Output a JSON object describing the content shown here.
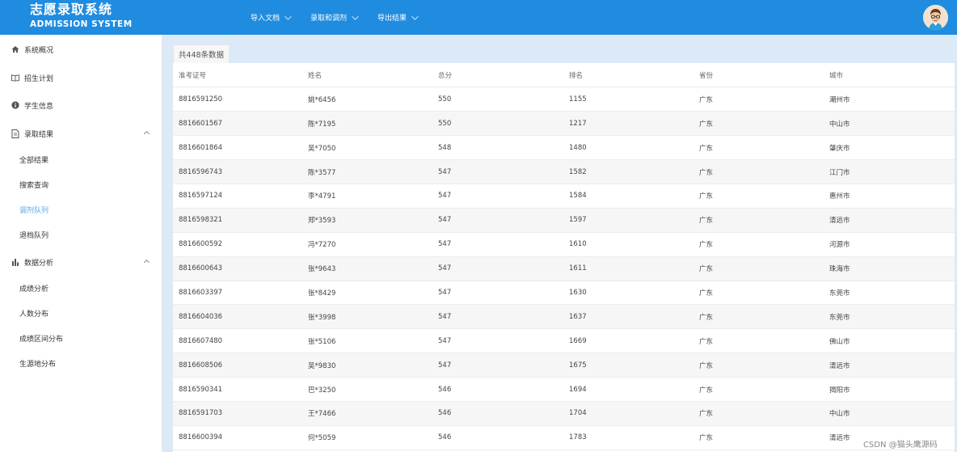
{
  "header": {
    "title_cn": "志愿录取系统",
    "title_en": "ADMISSION SYSTEM",
    "nav": [
      {
        "label": "导入文档"
      },
      {
        "label": "录取和调剂"
      },
      {
        "label": "导出结果"
      }
    ]
  },
  "sidebar": {
    "items": [
      {
        "label": "系统概况",
        "icon": "home-icon"
      },
      {
        "label": "招生计划",
        "icon": "book-icon"
      },
      {
        "label": "学生信息",
        "icon": "info-icon"
      },
      {
        "label": "录取结果",
        "icon": "document-icon"
      },
      {
        "label": "数据分析",
        "icon": "bar-chart-icon"
      }
    ],
    "results_sub": [
      {
        "label": "全部结果"
      },
      {
        "label": "搜索查询"
      },
      {
        "label": "调剂队列"
      },
      {
        "label": "退档队列"
      }
    ],
    "analysis_sub": [
      {
        "label": "成绩分析"
      },
      {
        "label": "人数分布"
      },
      {
        "label": "成绩区间分布"
      },
      {
        "label": "生源地分布"
      }
    ]
  },
  "main": {
    "tab_label": "共448条数据",
    "columns": [
      "准考证号",
      "姓名",
      "总分",
      "排名",
      "省份",
      "城市"
    ],
    "rows": [
      [
        "8816591250",
        "姚*6456",
        "550",
        "1155",
        "广东",
        "潮州市"
      ],
      [
        "8816601567",
        "陈*7195",
        "550",
        "1217",
        "广东",
        "中山市"
      ],
      [
        "8816601864",
        "吴*7050",
        "548",
        "1480",
        "广东",
        "肇庆市"
      ],
      [
        "8816596743",
        "陈*3577",
        "547",
        "1582",
        "广东",
        "江门市"
      ],
      [
        "8816597124",
        "李*4791",
        "547",
        "1584",
        "广东",
        "惠州市"
      ],
      [
        "8816598321",
        "郑*3593",
        "547",
        "1597",
        "广东",
        "清远市"
      ],
      [
        "8816600592",
        "冯*7270",
        "547",
        "1610",
        "广东",
        "河源市"
      ],
      [
        "8816600643",
        "张*9643",
        "547",
        "1611",
        "广东",
        "珠海市"
      ],
      [
        "8816603397",
        "张*8429",
        "547",
        "1630",
        "广东",
        "东莞市"
      ],
      [
        "8816604036",
        "张*3998",
        "547",
        "1637",
        "广东",
        "东莞市"
      ],
      [
        "8816607480",
        "张*5106",
        "547",
        "1669",
        "广东",
        "佛山市"
      ],
      [
        "8816608506",
        "吴*9830",
        "547",
        "1675",
        "广东",
        "清远市"
      ],
      [
        "8816590341",
        "巴*3250",
        "546",
        "1694",
        "广东",
        "揭阳市"
      ],
      [
        "8816591703",
        "王*7466",
        "546",
        "1704",
        "广东",
        "中山市"
      ],
      [
        "8816600394",
        "何*5059",
        "546",
        "1783",
        "广东",
        "清远市"
      ]
    ]
  },
  "watermark": "CSDN @猫头鹰源码",
  "colors": {
    "header_bg": "#1f8ce0",
    "main_bg": "#dbeaf6",
    "active_sub": "#5aa3e3"
  }
}
